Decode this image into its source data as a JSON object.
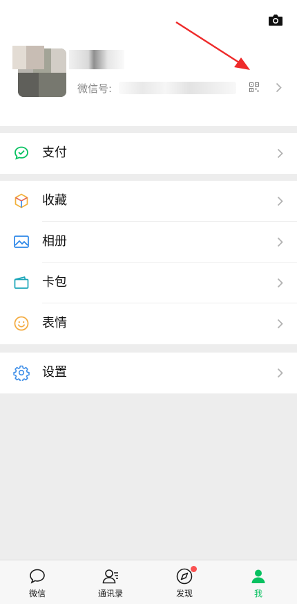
{
  "profile": {
    "wechat_id_label": "微信号:",
    "icons": {
      "camera": "camera-icon",
      "qr": "qr-code-icon",
      "chevron": "chevron-right-icon"
    },
    "arrow_color": "#ee2a2a"
  },
  "menu_groups": [
    {
      "items": [
        {
          "label": "支付",
          "icon": "pay-icon"
        }
      ]
    },
    {
      "items": [
        {
          "label": "收藏",
          "icon": "favorites-cube-icon"
        },
        {
          "label": "相册",
          "icon": "album-photo-icon"
        },
        {
          "label": "卡包",
          "icon": "card-wallet-icon"
        },
        {
          "label": "表情",
          "icon": "sticker-smile-icon"
        }
      ]
    },
    {
      "items": [
        {
          "label": "设置",
          "icon": "settings-gear-icon"
        }
      ]
    }
  ],
  "tabbar": {
    "tabs": [
      {
        "label": "微信",
        "icon": "chat-bubble-icon",
        "active": false
      },
      {
        "label": "通讯录",
        "icon": "contacts-icon",
        "active": false
      },
      {
        "label": "发现",
        "icon": "discover-compass-icon",
        "active": false,
        "badge": true
      },
      {
        "label": "我",
        "icon": "me-person-icon",
        "active": true
      }
    ],
    "active_color": "#07c160",
    "badge_color": "#fa5151"
  }
}
